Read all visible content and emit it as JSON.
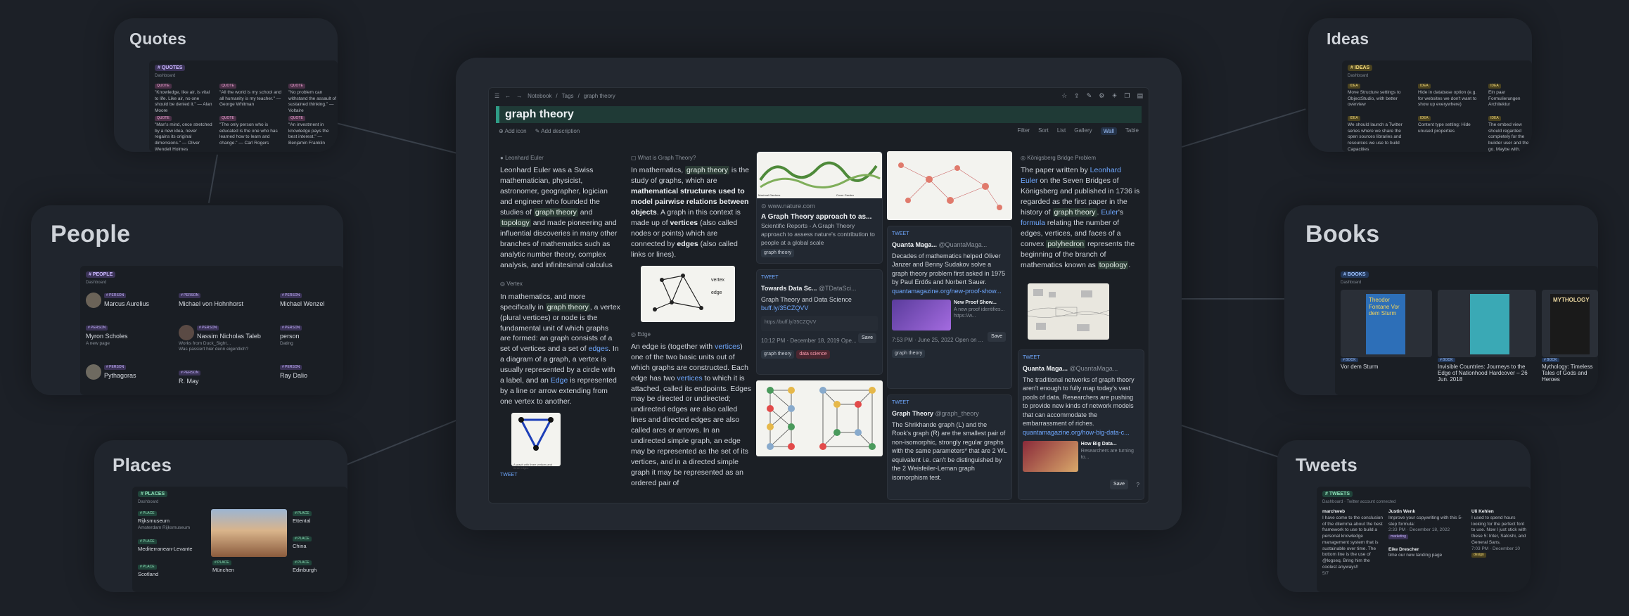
{
  "side_titles": {
    "quotes": "Quotes",
    "people": "People",
    "places": "Places",
    "ideas": "Ideas",
    "books": "Books",
    "tweets": "Tweets"
  },
  "mini_tags": {
    "quotes": "# QUOTES",
    "people": "# PEOPLE",
    "places": "# PLACES",
    "ideas": "# IDEAS",
    "books": "# BOOKS",
    "tweets": "# TWEETS"
  },
  "mini_sub": {
    "dashboard": "Dashboard",
    "tweets_extra": "Twitter account connected"
  },
  "quotes_items": [
    "\"Knowledge, like air, is vital to life. Like air, no one should be denied it.\" — Alan Moore",
    "\"All the world is my school and all humanity is my teacher.\" — George Whitman",
    "\"No problem can withstand the assault of sustained thinking.\" — Voltaire",
    "\"Man's mind, once stretched by a new idea, never regains its original dimensions.\" — Oliver Wendell Holmes",
    "\"The only person who is educated is the one who has learned how to learn and change.\" — Carl Rogers",
    "\"An investment in knowledge pays the best interest.\" — Benjamin Franklin"
  ],
  "people_items": [
    {
      "badge": "# PERSON",
      "name": "Marcus Aurelius"
    },
    {
      "badge": "# PERSON",
      "name": "Michael von Hohnhorst"
    },
    {
      "badge": "# PERSON",
      "name": "Michael Wenzel"
    },
    {
      "badge": "# PERSON",
      "name": "Myron Scholes"
    },
    {
      "badge": "# PERSON",
      "name": "Nassim Nicholas Taleb"
    },
    {
      "badge": "# PERSON",
      "name": "person"
    },
    {
      "badge": "# PERSON",
      "name": "Pythagoras"
    },
    {
      "badge": "# PERSON",
      "name": "R. May"
    },
    {
      "badge": "# PERSON",
      "name": "Ray Dalio"
    }
  ],
  "people_notes": {
    "taleb_1": "Works from Duck_Sight…",
    "taleb_2": "Was passiert hier denn eigentlich?",
    "myron": "A new page",
    "person": "Dating"
  },
  "places_items": [
    {
      "badge": "# PLACE",
      "name": "Rijksmuseum"
    },
    {
      "badge": "# PLACE",
      "name": "Mediterranean-Levante"
    },
    {
      "badge": "# PLACE",
      "name": "Scotland"
    },
    {
      "badge": "# PLACE",
      "name": "München"
    },
    {
      "badge": "# PLACE",
      "name": "Ettental"
    },
    {
      "badge": "# PLACE",
      "name": "China"
    },
    {
      "badge": "# PLACE",
      "name": "Edinburgh"
    }
  ],
  "places_notes": {
    "rijks_1": "Amsterdam",
    "rijks_2": "Rijksmuseum"
  },
  "ideas_items": [
    "Move Structure settings to ObjectStudio, with better overview",
    "Hide in database option (e.g. for websites we don't want to show up everywhere)",
    "Ein paar Formulierungen Architektur",
    "We should launch a Twitter series where we share the open sources libraries and resources we use to build Capacities",
    "Content type setting: Hide unused properties",
    "The embed view should regarded completely for the builder user and the go. Maybe with..."
  ],
  "books_items": [
    {
      "badge": "# BOOK",
      "title": "Vor dem Sturm",
      "cover": "Theodor Fontane Vor dem Sturm"
    },
    {
      "badge": "# BOOK",
      "title": "Invisible Countries: Journeys to the Edge of Nationhood Hardcover – 26 Jun. 2018",
      "cover": ""
    },
    {
      "badge": "# BOOK",
      "title": "Mythology: Timeless Tales of Gods and Heroes",
      "cover": "MYTHOLOGY"
    }
  ],
  "tweets_items": [
    {
      "user": "marchweb",
      "text": "I have come to the conclusion of the dilemma about the best framework to use to build a personal knowledge management system that is sustainable over time. The bottom line is the use of @logseq. Bring him the coolest anyways!!",
      "meta": "5/7"
    },
    {
      "user": "Justin Wenk",
      "text": "Improve your copywriting with this 5-step formula:",
      "meta": "2:33 PM · December 18, 2022",
      "tag": "marketing"
    },
    {
      "user": "Eike Drescher",
      "text": "time our new landing page",
      "meta": ""
    },
    {
      "user": "Uli Kehlen",
      "text": "I used to spend hours looking for the perfect font to use. Now I just stick with these 5: Inter, Satoshi, and General Sans.",
      "meta": "7:03 PM · December 10",
      "tag": "design"
    }
  ],
  "app": {
    "crumbs": [
      "Notebook",
      "Tags",
      "graph theory"
    ],
    "title": "graph theory",
    "add_icon": "Add icon",
    "add_description": "Add description",
    "views": [
      "Filter",
      "Sort",
      "List",
      "Gallery",
      "Wall",
      "Table"
    ],
    "active_view": "Wall"
  },
  "col1": {
    "head": "Leonhard Euler",
    "p1_a": "Leonhard Euler was a Swiss mathematician, physicist, astronomer, geographer, logician and engineer who founded the studies of ",
    "p1_hl": "graph theory",
    "p1_b": " and ",
    "p1_hl2": "topology",
    "p1_c": " and made pioneering and influential discoveries in many other branches of mathematics such as analytic number theory, complex analysis, and infinitesimal calculus",
    "head2": "Vertex",
    "p2_a": "In mathematics, and more specifically in ",
    "p2_hl": "graph theory",
    "p2_b": ", a vertex (plural vertices) or node is the fundamental unit of which graphs are formed: an graph consists of a set of vertices and a set of ",
    "p2_link": "edges",
    "p2_c": ". In a diagram of a graph, a vertex is usually represented by a circle with a label, and an ",
    "p2_link2": "Edge",
    "p2_d": " is represented by a line or arrow extending from one vertex to another.",
    "fig_caption": "A graph with three vertices and three edges.",
    "tweet": "TWEET"
  },
  "col2": {
    "head": "What is Graph Theory?",
    "p1_a": "In mathematics, ",
    "p1_hl": "graph theory",
    "p1_b": " is the study of graphs, which are ",
    "p1_bold": "mathematical structures used to model pairwise relations between objects",
    "p1_c": ". A graph in this context is made up of ",
    "p1_bold2": "vertices",
    "p1_d": " (also called nodes or points) which are connected by ",
    "p1_bold3": "edges",
    "p1_e": " (also called links or lines).",
    "fig_vertex": "vertex",
    "fig_edge": "edge",
    "head2": "Edge",
    "p2_a": "An edge is (together with ",
    "p2_link": "vertices",
    "p2_b": ") one of the two basic units out of which graphs are constructed. Each edge has two ",
    "p2_link2": "vertices",
    "p2_c": " to which it is attached, called its endpoints. Edges may be directed or undirected; undirected edges are also called lines and directed edges are also called arcs or arrows. In an undirected simple graph, an edge may be represented as the set of its vertices, and in a directed simple graph it may be represented as an ordered pair of"
  },
  "col3": {
    "web_source": "www.nature.com",
    "web_title": "A Graph Theory approach to as...",
    "web_desc": "Scientific Reports - A Graph Theory approach to assess nature's contribution to people at a global scale",
    "web_tag": "graph theory",
    "tweet_label": "TWEET",
    "tweet_user": "Towards Data Sc...",
    "tweet_handle": "@TDataSci...",
    "tweet_text": "Graph Theory and Data Science",
    "tweet_link": "buff.ly/35CZQVV",
    "tweet_preview": "https://buff.ly/35CZQVV",
    "save": "Save",
    "tweet_time": "10:12 PM · December 18, 2019",
    "tweet_open": "Ope...",
    "tags": [
      "graph theory",
      "data science"
    ],
    "img_left_caption": "Maximal Gardens",
    "img_right_caption": "Cover Garden"
  },
  "col4": {
    "tweet_label": "TWEET",
    "user": "Quanta Maga...",
    "handle": "@QuantaMaga...",
    "text": "Decades of mathematics helped Oliver Janzer and Benny Sudakov solve a graph theory problem first asked in 1975 by Paul Erdős and Norbert Sauer.",
    "link": "quantamagazine.org/new-proof-show...",
    "preview_title": "New Proof Show...",
    "preview_desc": "A new proof identifies...",
    "preview_url": "https://w...",
    "save": "Save",
    "time": "7:53 PM · June 25, 2022",
    "open": "Open on ...",
    "tag": "graph theory",
    "tweet2_label": "TWEET",
    "user2": "Graph Theory",
    "handle2": "@graph_theory",
    "text2": "The Shrikhande graph (L) and the Rook's graph (R) are the smallest pair of non-isomorphic, strongly regular graphs with the same parameters* that are 2 WL equivalent i.e. can't be distinguished by the 2 Weisfeiler-Leman graph isomorphism test."
  },
  "col5": {
    "head": "Königsberg Bridge Problem",
    "p1_a": "The paper written by ",
    "p1_link": "Leonhard Euler",
    "p1_b": " on the Seven Bridges of Königsberg and published in 1736 is regarded as the first paper in the history of ",
    "p1_hl": "graph theory",
    "p1_c": ". ",
    "p1_link2": "Euler",
    "p1_d": "'s ",
    "p1_link3": "formula",
    "p1_e": " relating the number of edges, vertices, and faces of a convex ",
    "p1_hl2": "polyhedron",
    "p1_f": " represents the beginning of the branch of mathematics known as ",
    "p1_hl3": "topology",
    "p1_g": ".",
    "tweet_label": "TWEET",
    "user": "Quanta Maga...",
    "handle": "@QuantaMaga...",
    "text": "The traditional networks of graph theory aren't enough to fully map today's vast pools of data. Researchers are pushing to provide new kinds of network models that can accommodate the embarrassment of riches.",
    "link": "quantamagazine.org/how-big-data-c...",
    "preview_title": "How Big Data...",
    "preview_desc": "Researchers are turning to...",
    "save": "Save",
    "help": "?"
  },
  "colors": {
    "bg": "#1c2027",
    "accent": "#2f9c86",
    "link": "#6fa8ff"
  }
}
